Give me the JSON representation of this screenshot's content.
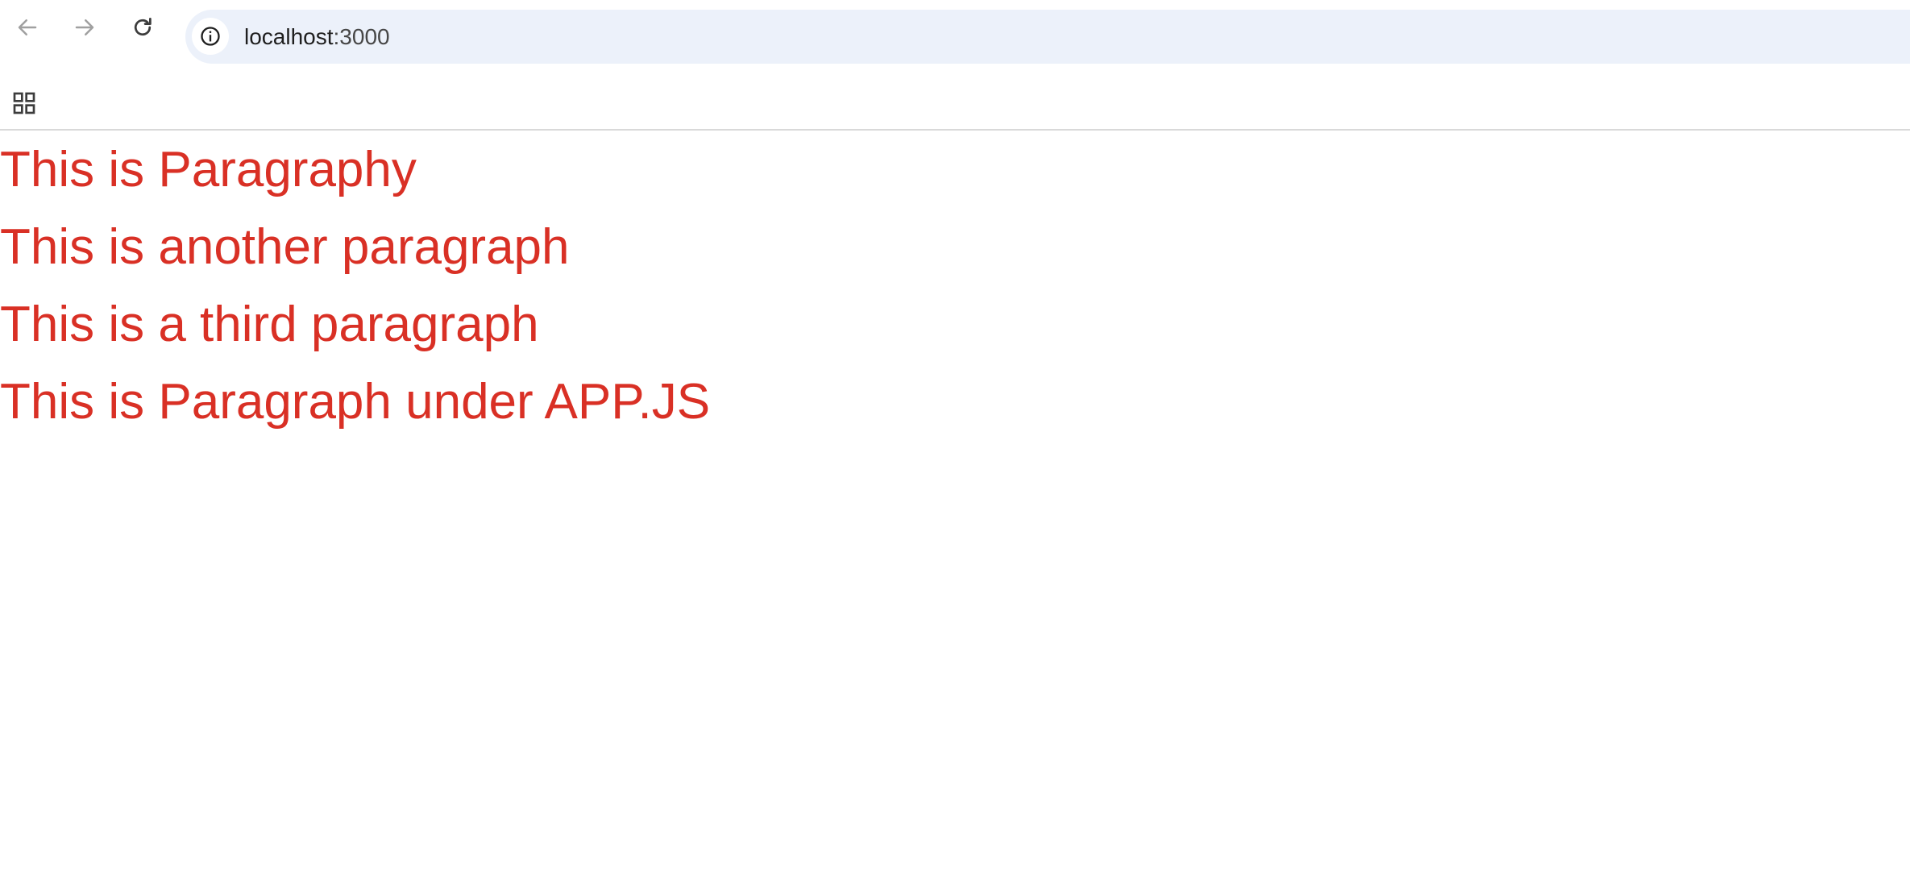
{
  "browser": {
    "url_host": "localhost",
    "url_port": ":3000",
    "icons": {
      "back": "arrow-back-icon",
      "forward": "arrow-forward-icon",
      "reload": "reload-icon",
      "site_info": "info-icon",
      "apps": "apps-grid-icon"
    }
  },
  "page": {
    "text_color": "#d93025",
    "paragraphs": [
      "This is Paragraphy",
      "This is another paragraph",
      "This is a third paragraph",
      "This is Paragraph under APP.JS"
    ]
  }
}
